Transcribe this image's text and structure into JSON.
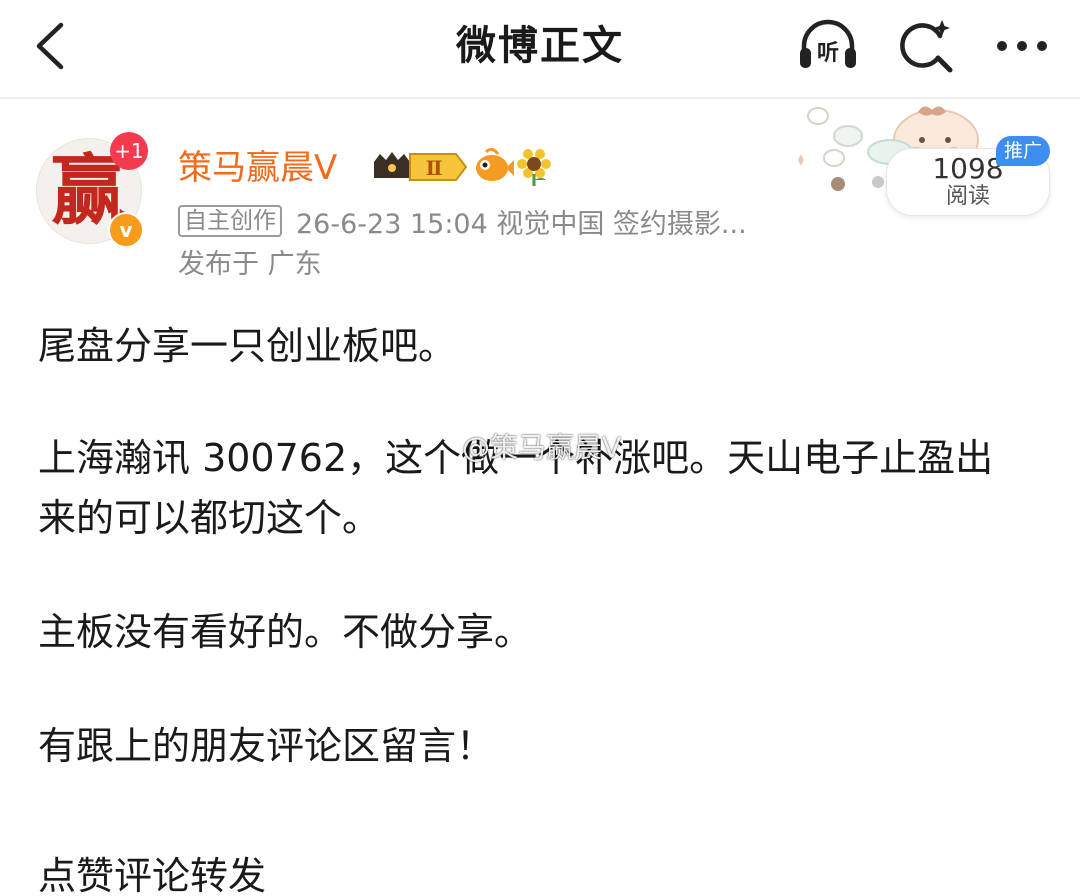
{
  "nav": {
    "title": "微博正文",
    "back_icon": "chevron-left-icon",
    "listen_label": "听",
    "search_icon": "search-sparkle-icon",
    "more_icon": "more-dots-icon"
  },
  "author": {
    "avatar_char": "赢",
    "plus_badge": "+1",
    "verified_mark": "v",
    "name": "策马赢晨V",
    "crown_level": "Ⅱ"
  },
  "meta": {
    "tag": "自主创作",
    "info": "26-6-23 15:04  视觉中国 签约摄影...",
    "location": "发布于 广东"
  },
  "reads": {
    "count": "1098",
    "label": "阅读",
    "promo": "推广"
  },
  "content": {
    "p1": "尾盘分享一只创业板吧。",
    "p2_line1": "上海瀚讯 300762，这个做一个补涨吧。天山电子止盈出",
    "p2_line2": "来的可以都切这个。",
    "p3": "主板没有看好的。不做分享。",
    "p4": "有跟上的朋友评论区留言！",
    "watermark": "@策马赢晨V",
    "cut_line": "点赞评论转发"
  },
  "colors": {
    "accent_orange": "#f26a1b",
    "badge_red": "#f43b4e",
    "promo_blue": "#3d8ef0",
    "meta_gray": "#8a8a8a"
  }
}
